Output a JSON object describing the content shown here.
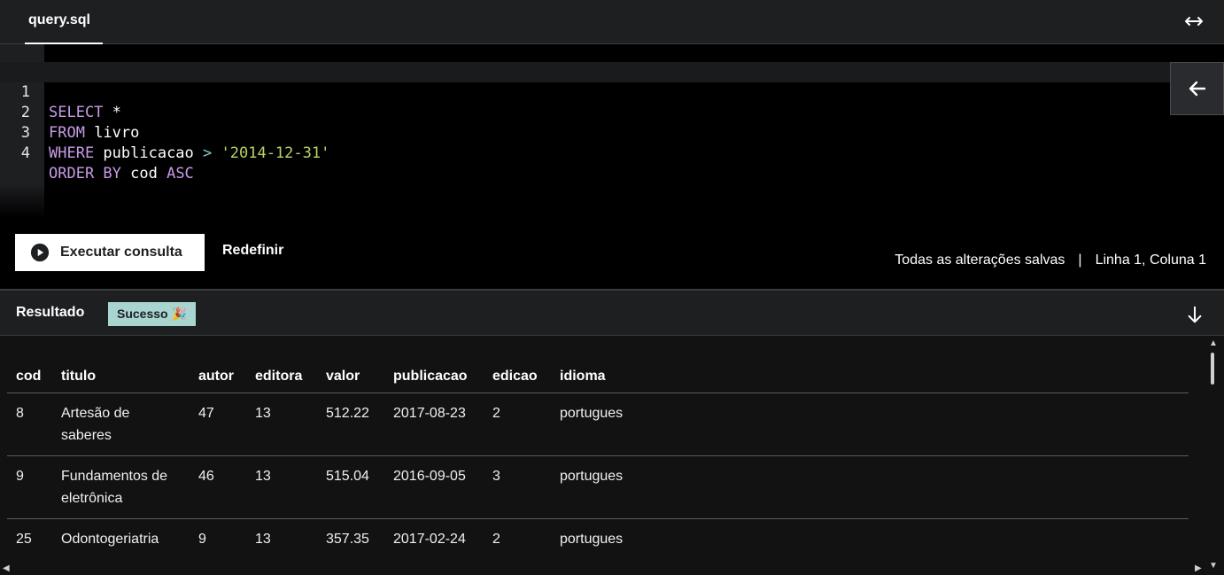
{
  "tabbar": {
    "tab_label": "query.sql"
  },
  "editor": {
    "lines": [
      {
        "number": "1"
      },
      {
        "number": "2"
      },
      {
        "number": "3"
      },
      {
        "number": "4"
      }
    ],
    "tokens": {
      "l1_kw": "SELECT",
      "l1_rest": " *",
      "l2_kw": "FROM",
      "l2_rest": " livro",
      "l3_kw": "WHERE",
      "l3_mid": " publicacao ",
      "l3_op": ">",
      "l3_space": " ",
      "l3_str": "'2014-12-31'",
      "l4_kw1": "ORDER BY",
      "l4_mid": " cod ",
      "l4_kw2": "ASC"
    }
  },
  "actions": {
    "run_label": "Executar consulta",
    "reset_label": "Redefinir",
    "save_status": "Todas as alterações salvas",
    "separator": "|",
    "cursor_position": "Linha 1, Coluna 1"
  },
  "results": {
    "title": "Resultado",
    "badge": "Sucesso 🎉",
    "columns": [
      "cod",
      "titulo",
      "autor",
      "editora",
      "valor",
      "publicacao",
      "edicao",
      "idioma"
    ],
    "rows": [
      [
        "8",
        "Artesão de saberes",
        "47",
        "13",
        "512.22",
        "2017-08-23",
        "2",
        "portugues"
      ],
      [
        "9",
        "Fundamentos de eletrônica",
        "46",
        "13",
        "515.04",
        "2016-09-05",
        "3",
        "portugues"
      ],
      [
        "25",
        "Odontogeriatria",
        "9",
        "13",
        "357.35",
        "2017-02-24",
        "2",
        "portugues"
      ]
    ]
  },
  "colors": {
    "badge": "#a8d5cf",
    "keyword": "#c89be6",
    "string": "#b7d364",
    "operator": "#7fd0d0"
  },
  "icons": {
    "expand": "horizontal-arrows-icon",
    "collapse": "arrow-left-icon",
    "play": "play-circle-icon",
    "download": "arrow-down-icon"
  }
}
